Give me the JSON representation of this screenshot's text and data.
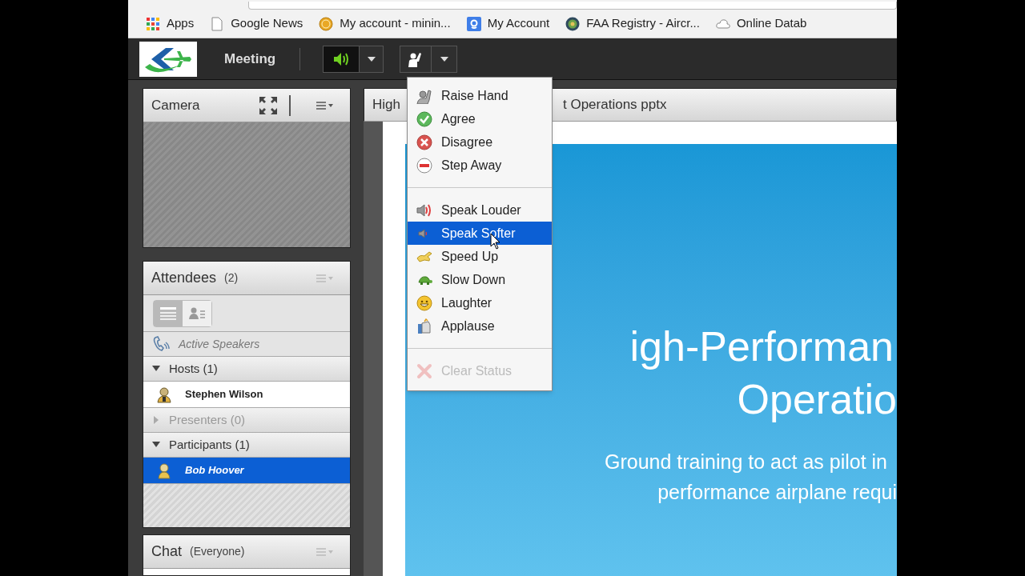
{
  "bookmarks": [
    {
      "label": "Apps",
      "kind": "apps"
    },
    {
      "label": "Google News",
      "kind": "page"
    },
    {
      "label": "My account - minin...",
      "kind": "coin"
    },
    {
      "label": "My Account",
      "kind": "g"
    },
    {
      "label": "FAA Registry - Aircr...",
      "kind": "seal"
    },
    {
      "label": "Online Datab",
      "kind": "cloud"
    }
  ],
  "toolbar": {
    "title": "Meeting",
    "audio_on": true
  },
  "camera_pod": {
    "title": "Camera"
  },
  "attendees_pod": {
    "title": "Attendees",
    "count": "(2)",
    "view_toggles": [
      {
        "kind": "list",
        "selected": true
      },
      {
        "kind": "cards",
        "selected": false
      }
    ],
    "active_speakers": "Active Speakers",
    "groups": [
      {
        "label": "Hosts (1)",
        "expanded": true,
        "disabled": false,
        "members": [
          {
            "name": "Stephen Wilson",
            "kind": "host",
            "selected": false
          }
        ]
      },
      {
        "label": "Presenters (0)",
        "expanded": false,
        "disabled": true
      },
      {
        "label": "Participants (1)",
        "expanded": true,
        "disabled": false,
        "members": [
          {
            "name": "Bob Hoover",
            "kind": "participant",
            "selected": true
          }
        ]
      }
    ]
  },
  "chat_pod": {
    "title": "Chat",
    "scope": "(Everyone)"
  },
  "share_pod": {
    "title_parts": [
      "High",
      "t Operations pptx"
    ],
    "slide": {
      "heading": [
        "igh-Performan",
        "Operatio"
      ],
      "subtitle": [
        "Ground training to act as pilot in",
        "performance airplane requi"
      ]
    }
  },
  "status_menu": {
    "sections": [
      [
        {
          "label": "Raise Hand",
          "kind": "raise_hand",
          "selected": false,
          "disabled": false
        },
        {
          "label": "Agree",
          "kind": "agree",
          "selected": false,
          "disabled": false
        },
        {
          "label": "Disagree",
          "kind": "disagree",
          "selected": false,
          "disabled": false
        },
        {
          "label": "Step Away",
          "kind": "step_away",
          "selected": false,
          "disabled": false
        }
      ],
      [
        {
          "label": "Speak Louder",
          "kind": "louder",
          "selected": false,
          "disabled": false
        },
        {
          "label": "Speak Softer",
          "kind": "softer",
          "selected": true,
          "disabled": false
        },
        {
          "label": "Speed Up",
          "kind": "speed_up",
          "selected": false,
          "disabled": false
        },
        {
          "label": "Slow Down",
          "kind": "slow_down",
          "selected": false,
          "disabled": false
        },
        {
          "label": "Laughter",
          "kind": "laughter",
          "selected": false,
          "disabled": false
        },
        {
          "label": "Applause",
          "kind": "applause",
          "selected": false,
          "disabled": false
        }
      ],
      [
        {
          "label": "Clear Status",
          "kind": "clear",
          "selected": false,
          "disabled": true
        }
      ]
    ]
  }
}
